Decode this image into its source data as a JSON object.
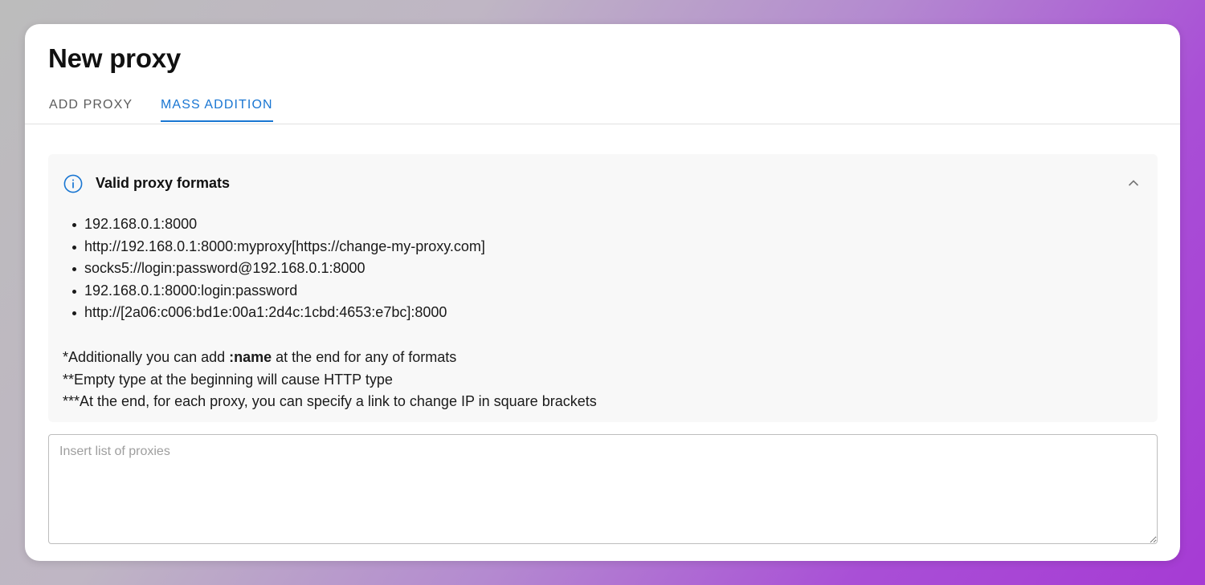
{
  "dialog": {
    "title": "New proxy",
    "tabs": [
      {
        "label": "ADD PROXY",
        "active": false
      },
      {
        "label": "MASS ADDITION",
        "active": true
      }
    ]
  },
  "info": {
    "title": "Valid proxy formats",
    "icon": "info-icon",
    "collapse_icon": "chevron-up-icon",
    "formats": [
      "192.168.0.1:8000",
      "http://192.168.0.1:8000:myproxy[https://change-my-proxy.com]",
      "socks5://login:password@192.168.0.1:8000",
      "192.168.0.1:8000:login:password",
      "http://[2a06:c006:bd1e:00a1:2d4c:1cbd:4653:e7bc]:8000"
    ],
    "note1_prefix": "*Additionally you can add ",
    "note1_bold": ":name",
    "note1_suffix": " at the end for any of formats",
    "note2": "**Empty type at the beginning will cause HTTP type",
    "note3": "***At the end, for each proxy, you can specify a link to change IP in square brackets"
  },
  "input": {
    "placeholder": "Insert list of proxies",
    "value": ""
  },
  "colors": {
    "accent": "#1976d2",
    "panel_bg": "#f8f8f8"
  }
}
